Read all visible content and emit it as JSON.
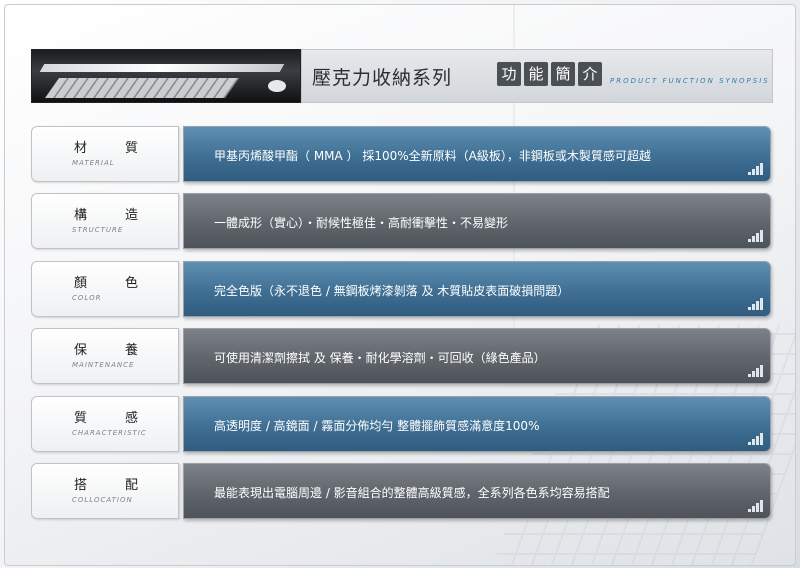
{
  "header": {
    "title": "壓克力收納系列",
    "boxes": [
      "功",
      "能",
      "簡",
      "介"
    ],
    "subtitle": "PRODUCT FUNCTION SYNOPSIS"
  },
  "rows": [
    {
      "cn": [
        "材",
        "質"
      ],
      "en": "MATERIAL",
      "value": "甲基丙烯酸甲酯（ MMA ）  採100%全新原料（A級板），非鋼板或木製質感可超越",
      "style": "blue"
    },
    {
      "cn": [
        "構",
        "造"
      ],
      "en": "STRUCTURE",
      "value": "一體成形（實心）・耐候性極佳・高耐衝擊性・不易變形",
      "style": "gray"
    },
    {
      "cn": [
        "顏",
        "色"
      ],
      "en": "COLOR",
      "value": "完全色版（永不退色 / 無鋼板烤漆剝落 及 木質貼皮表面破損問題）",
      "style": "blue"
    },
    {
      "cn": [
        "保",
        "養"
      ],
      "en": "MAINTENANCE",
      "value": "可使用清潔劑擦拭 及 保養・耐化學溶劑・可回收（綠色產品）",
      "style": "gray"
    },
    {
      "cn": [
        "質",
        "感"
      ],
      "en": "CHARACTERISTIC",
      "value": "高透明度 / 高鏡面 / 霧面分佈均勻    整體擺飾質感滿意度100%",
      "style": "blue"
    },
    {
      "cn": [
        "搭",
        "配"
      ],
      "en": "COLLOCATION",
      "value": "最能表現出電腦周邊 / 影音組合的整體高級質感，全系列各色系均容易搭配",
      "style": "gray"
    }
  ],
  "colors": {
    "blue": "#3f6f93",
    "gray": "#60656c",
    "accent": "#2f7fa8"
  },
  "icons": {
    "row_corner": "signal-bars-icon"
  }
}
